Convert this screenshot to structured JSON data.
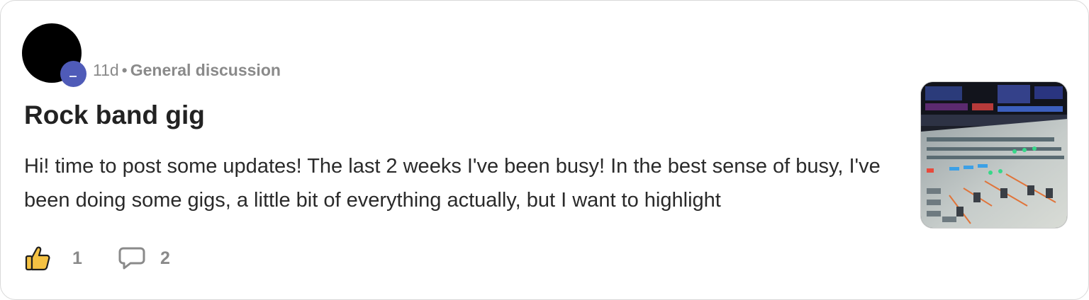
{
  "post": {
    "age": "11d",
    "separator": "•",
    "category": "General discussion",
    "title": "Rock band gig",
    "excerpt": "Hi! time to post some updates! The last 2 weeks I've been busy! In the best sense of busy, I've been doing some gigs, a little bit of everything actually, but I want to highlight",
    "thumbnail_icon": "mixing-console-photo"
  },
  "actions": {
    "like_icon": "thumbs-up-icon",
    "like_count": "1",
    "comment_icon": "comment-icon",
    "comment_count": "2"
  },
  "colors": {
    "avatar": "#000000",
    "avatar_badge": "#4f5bb8",
    "like_icon_fill": "#f5c243",
    "meta_text": "#8a8a8a"
  }
}
